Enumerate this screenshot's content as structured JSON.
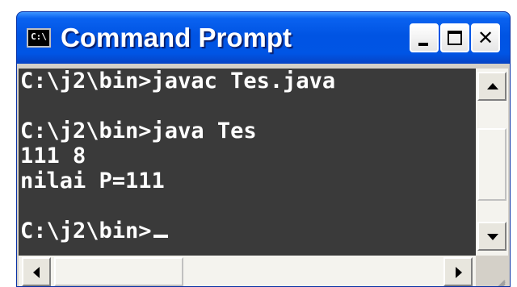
{
  "window": {
    "title": "Command Prompt",
    "app_icon_text": "C:\\",
    "title_color": "#0054e3"
  },
  "titlebar_buttons": {
    "minimize_icon": "minimize-icon",
    "maximize_icon": "maximize-icon",
    "close_icon": "close-icon",
    "close_glyph": "✕"
  },
  "console": {
    "background": "#3a3a3a",
    "foreground": "#ffffff",
    "lines": [
      "C:\\j2\\bin>javac Tes.java",
      "",
      "C:\\j2\\bin>java Tes",
      "111 8",
      "nilai P=111",
      "",
      "C:\\j2\\bin>"
    ]
  },
  "scrollbars": {
    "vertical": {
      "position_fraction": 0.15
    },
    "horizontal": {
      "position_fraction": 0.0
    }
  }
}
